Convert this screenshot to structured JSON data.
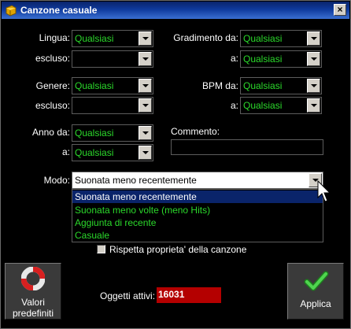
{
  "window": {
    "title": "Canzone casuale",
    "close_glyph": "×"
  },
  "filters": {
    "lingua": {
      "label": "Lingua:",
      "value": "Qualsiasi"
    },
    "lingua_escluso": {
      "label": "escluso:",
      "value": ""
    },
    "genere": {
      "label": "Genere:",
      "value": "Qualsiasi"
    },
    "genere_escluso": {
      "label": "escluso:",
      "value": ""
    },
    "anno_da": {
      "label": "Anno da:",
      "value": "Qualsiasi"
    },
    "anno_a": {
      "label": "a:",
      "value": "Qualsiasi"
    },
    "gradimento_da": {
      "label": "Gradimento da:",
      "value": "Qualsiasi"
    },
    "gradimento_a": {
      "label": "a:",
      "value": "Qualsiasi"
    },
    "bpm_da": {
      "label": "BPM da:",
      "value": "Qualsiasi"
    },
    "bpm_a": {
      "label": "a:",
      "value": "Qualsiasi"
    },
    "commento": {
      "label": "Commento:",
      "value": ""
    }
  },
  "modo": {
    "label": "Modo:",
    "value": "Suonata meno recentemente",
    "options": [
      "Suonata meno recentemente",
      "Suonata meno volte (meno Hits)",
      "Aggiunta di recente",
      "Casuale"
    ],
    "selected_index": 0
  },
  "rispetta": {
    "label": "Rispetta proprieta' della canzone",
    "checked": false
  },
  "buttons": {
    "defaults": {
      "line1": "Valori",
      "line2": "predefiniti",
      "icon": "lifebuoy-icon"
    },
    "apply": {
      "label": "Applica",
      "icon": "checkmark-icon"
    }
  },
  "oggetti": {
    "label": "Oggetti attivi:",
    "value": "16031"
  },
  "colors": {
    "value_text": "#2bd92b",
    "selection": "#0a246a",
    "counter_bg": "#b40000"
  }
}
